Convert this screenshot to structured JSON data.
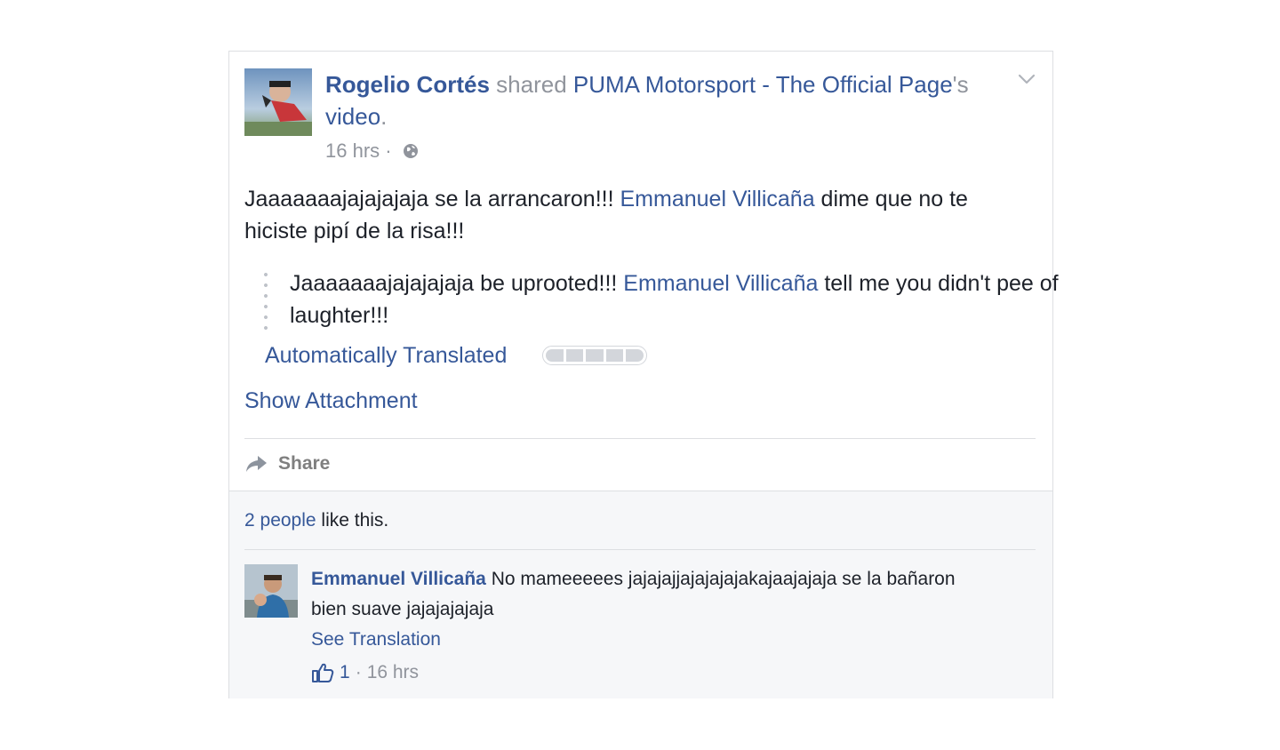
{
  "post": {
    "author": "Rogelio Cortés",
    "action": "shared",
    "shared_page": "PUMA Motorsport - The Official Page",
    "possessive": "'s",
    "shared_object": "video",
    "period": ".",
    "time": "16 hrs",
    "separator": "·",
    "text_part1": "Jaaaaaaajajajajaja se la arrancaron!!! ",
    "mention": "Emmanuel Villicaña",
    "text_part2": " dime que no te hiciste pipí de la risa!!!",
    "translation_part1": "Jaaaaaaajajajajaja be uprooted!!! ",
    "translation_part2": " tell me you didn't pee of laughter!!!",
    "auto_translated_label": "Automatically Translated",
    "translation_rating": "0/5",
    "show_attachment": "Show Attachment",
    "share_label": "Share"
  },
  "likes": {
    "count_link": "2 people",
    "suffix": " like this."
  },
  "comment": {
    "author": "Emmanuel Villicaña",
    "text": " No mameeeees jajajajjajajajajakajaajajaja se la bañaron bien suave jajajajajaja",
    "see_translation": "See Translation",
    "like_count": "1",
    "separator": "·",
    "time": "16 hrs"
  },
  "icons": {
    "chevron": "chevron-down-icon",
    "globe": "globe-icon",
    "share": "share-arrow-icon",
    "like": "thumbs-up-icon"
  },
  "colors": {
    "link": "#365899",
    "meta": "#90949c",
    "text": "#1d2129",
    "footer_bg": "#f6f7f9"
  }
}
